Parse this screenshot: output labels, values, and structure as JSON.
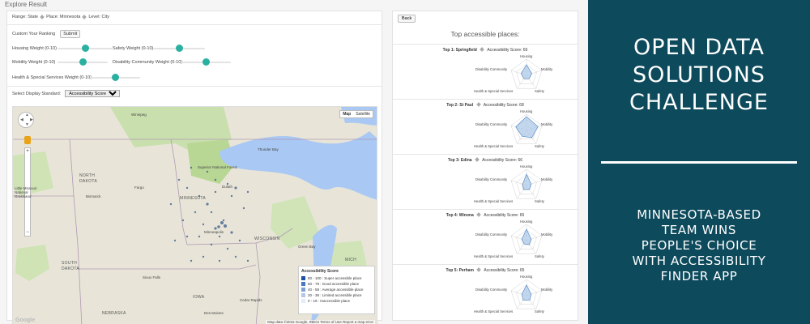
{
  "page_title": "Explore Result",
  "breadcrumb": {
    "range": "Range: State",
    "place": "Place: Minnesota",
    "level": "Level: City"
  },
  "ranking": {
    "label": "Custom Your Ranking",
    "submit": "Submit"
  },
  "weights": [
    {
      "label": "Housing Weight (0-10)",
      "value": 0.5
    },
    {
      "label": "Safety Weight (0-10)",
      "value": 0.5
    },
    {
      "label": "Mobility Weight (0-10)",
      "value": 0.5
    },
    {
      "label": "Disability Community Weight (0-10)",
      "value": 0.5
    },
    {
      "label": "Health & Special Services Weight (0-10)",
      "value": 0.5
    }
  ],
  "display": {
    "label": "Select Display Standard:",
    "selected": "Accessibility Score"
  },
  "map": {
    "type_map": "Map",
    "type_satellite": "Satellite",
    "labels": {
      "winnipeg": "Winnipeg",
      "north_dakota": "NORTH\nDAKOTA",
      "bismarck": "Bismarck",
      "fargo": "Fargo",
      "thunder_bay": "Thunder Bay",
      "minnesota": "MINNESOTA",
      "duluth": "Duluth",
      "minneapolis": "Minneapolis",
      "south_dakota": "SOUTH\nDAKOTA",
      "sioux_falls": "Sioux Falls",
      "wisconsin": "WISCONSIN",
      "green_bay": "Green Bay",
      "iowa": "IOWA",
      "cedar_rapids": "Cedar Rapids",
      "des_moines": "Des Moines",
      "nebraska": "NEBRASKA",
      "michigan": "MICH",
      "little_missouri": "Little Missouri\nNational\nGrassland",
      "superior": "Superior National Forest",
      "milwaukee": "Milwa..."
    },
    "legend": {
      "title": "Accessibility Score",
      "items": [
        {
          "label": "80 - 100 : Super accessible place",
          "color": "#1f4fa3"
        },
        {
          "label": "60 - 79 : Good accessible place",
          "color": "#4a78c0"
        },
        {
          "label": "40 - 59 : Average accessible place",
          "color": "#7da1d6"
        },
        {
          "label": "20 - 39 : Limited accessible place",
          "color": "#b3c8e8"
        },
        {
          "label": "0 - 19 : Inaccessible place",
          "color": "#e3ecf7"
        }
      ]
    },
    "attribution": "Map data ©2015 Google, INEGI    Terms of Use    Report a map error",
    "google": "Google"
  },
  "results": {
    "back": "Back",
    "title": "Top accessible places:",
    "axes": {
      "housing": "Housing",
      "mobility": "Mobility",
      "safety": "Safety",
      "health": "Health & Special Services",
      "disability": "Disability Community"
    },
    "places": [
      {
        "rank": "Top 1: Springfield",
        "score": "Accessibility Score: 69"
      },
      {
        "rank": "Top 2: St Paul",
        "score": "Accessibility Score: 68"
      },
      {
        "rank": "Top 3: Edina",
        "score": "Accessibility Score: 66"
      },
      {
        "rank": "Top 4: Winona",
        "score": "Accessibility Score: 65"
      },
      {
        "rank": "Top 5: Perham",
        "score": "Accessibility Score: 65"
      }
    ]
  },
  "promo": {
    "headline": [
      "OPEN DATA",
      "SOLUTIONS",
      "CHALLENGE"
    ],
    "subhead": [
      "MINNESOTA-BASED",
      "TEAM WINS",
      "PEOPLE'S CHOICE",
      "WITH ACCESSIBILITY",
      "FINDER APP"
    ]
  }
}
